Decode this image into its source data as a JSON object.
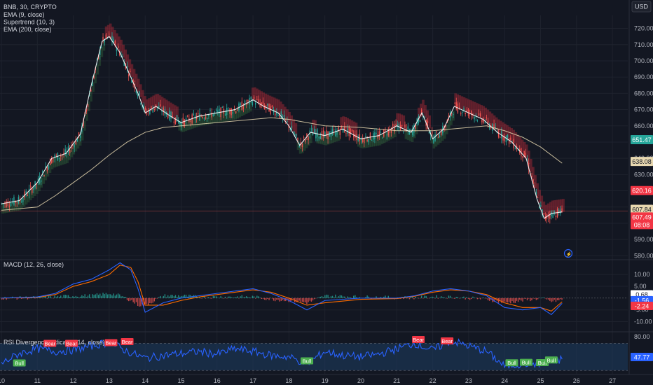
{
  "header": {
    "symbol": "BNB, 30, CRYPTO",
    "indicators": [
      "EMA (9, close)",
      "Supertrend (10, 3)",
      "EMA (200, close)"
    ],
    "currency_button": "USD"
  },
  "colors": {
    "background": "#131722",
    "grid": "#1e222d",
    "bull": "#26a69a",
    "bear": "#ef5350",
    "ema9": "#ffffff",
    "ema200": "#e8d8b0",
    "supertrend_up": "#4caf50",
    "supertrend_down": "#b02a38",
    "macd_line": "#2962ff",
    "signal_line": "#ff6d00",
    "rsi_line": "#2962ff",
    "rsi_band": "#1c3a5e"
  },
  "chart_data": [
    {
      "type": "line",
      "panel": "price",
      "title": "BNB, 30, CRYPTO",
      "x_ticks": [
        "10",
        "11",
        "12",
        "13",
        "14",
        "15",
        "16",
        "17",
        "18",
        "19",
        "20",
        "21",
        "22",
        "23",
        "24",
        "25",
        "26",
        "27"
      ],
      "y_ticks": [
        "720.00",
        "710.00",
        "700.00",
        "690.00",
        "680.00",
        "670.00",
        "660.00",
        "650.00",
        "640.00",
        "630.00",
        "620.00",
        "610.00",
        "600.00",
        "590.00",
        "580.00"
      ],
      "ylim": [
        578,
        728
      ],
      "grid": true,
      "series": [
        {
          "name": "EMA (9, close)",
          "x": [
            10,
            10.5,
            11,
            11.4,
            11.8,
            12.2,
            12.5,
            12.8,
            13.0,
            13.3,
            13.6,
            13.8,
            14.0,
            14.3,
            14.7,
            15.0,
            15.5,
            16.0,
            16.5,
            17.0,
            17.3,
            17.7,
            18.0,
            18.3,
            18.6,
            19.0,
            19.5,
            20.0,
            20.5,
            21.0,
            21.4,
            21.7,
            22.0,
            22.3,
            22.6,
            23.0,
            23.4,
            23.8,
            24.2,
            24.6,
            24.9,
            25.1,
            25.3,
            25.6
          ],
          "values": [
            612,
            614,
            625,
            640,
            643,
            655,
            685,
            712,
            715,
            705,
            690,
            680,
            668,
            672,
            666,
            662,
            666,
            668,
            670,
            676,
            672,
            668,
            660,
            648,
            656,
            654,
            658,
            652,
            654,
            660,
            656,
            668,
            652,
            658,
            672,
            668,
            664,
            656,
            650,
            640,
            615,
            603,
            606,
            607
          ]
        },
        {
          "name": "EMA (200, close)",
          "x": [
            10,
            11,
            11.5,
            12,
            12.5,
            13,
            13.5,
            14,
            14.5,
            15,
            16,
            17,
            17.5,
            18,
            18.5,
            19,
            20,
            21,
            22,
            23,
            23.5,
            24,
            24.5,
            25,
            25.6
          ],
          "values": [
            608,
            610,
            617,
            625,
            633,
            642,
            650,
            656,
            659,
            660,
            662,
            664,
            665,
            664,
            662,
            660,
            659,
            657,
            657,
            659,
            660,
            657,
            653,
            647,
            637
          ]
        }
      ],
      "price_labels": [
        "651.47",
        "638.08",
        "620.16",
        "607.84",
        "607.49",
        "08:08"
      ]
    },
    {
      "type": "line",
      "panel": "macd",
      "title": "MACD (12, 26, close)",
      "y_ticks": [
        "10.00",
        "5.00",
        "-5.00",
        "-10.00"
      ],
      "ylim": [
        -14,
        16
      ],
      "series": [
        {
          "name": "MACD",
          "x": [
            10,
            11,
            11.5,
            12,
            12.5,
            13,
            13.3,
            13.6,
            13.8,
            14.0,
            14.5,
            15,
            15.5,
            16,
            16.5,
            17,
            17.5,
            18,
            18.5,
            19,
            20,
            21,
            21.5,
            22,
            22.5,
            23,
            23.5,
            24,
            24.5,
            25,
            25.3,
            25.6
          ],
          "values": [
            0,
            0.5,
            2,
            6,
            8,
            12,
            15,
            12,
            4,
            -6,
            -2,
            0,
            1,
            2,
            3,
            4,
            2,
            -1,
            -5,
            -1,
            0,
            0,
            1,
            3,
            4,
            3,
            1,
            -4,
            -5,
            -4,
            -7,
            -2.24
          ]
        },
        {
          "name": "Signal",
          "x": [
            10,
            11,
            11.5,
            12,
            12.5,
            13,
            13.3,
            13.6,
            13.8,
            14.0,
            14.5,
            15,
            15.5,
            16,
            16.5,
            17,
            17.5,
            18,
            18.5,
            19,
            20,
            21,
            21.5,
            22,
            22.5,
            23,
            23.5,
            24,
            24.5,
            25,
            25.3,
            25.6
          ],
          "values": [
            0,
            0.3,
            1.5,
            5,
            7,
            10,
            14,
            13,
            7,
            -3,
            -3,
            -1,
            0.5,
            1.5,
            2.5,
            3.5,
            2.5,
            0,
            -3,
            -2,
            -0.5,
            -0.2,
            0.8,
            2.5,
            3.5,
            3,
            1.5,
            -2,
            -4,
            -4,
            -5.5,
            -1.56
          ]
        }
      ],
      "price_labels": [
        "0.68",
        "-1.56",
        "-2.24"
      ]
    },
    {
      "type": "line",
      "panel": "rsi",
      "title": "RSI Divergence Indicator (14, close)",
      "y_ticks": [
        "80.00"
      ],
      "ylim": [
        25,
        85
      ],
      "band": [
        30,
        70
      ],
      "series": [
        {
          "name": "RSI",
          "x": [
            10,
            10.5,
            11,
            11.5,
            12,
            12.5,
            13,
            13.5,
            14,
            14.5,
            15,
            15.5,
            16,
            16.5,
            17,
            17.5,
            18,
            18.5,
            19,
            19.5,
            20,
            20.5,
            21,
            21.5,
            22,
            22.5,
            23,
            23.5,
            24,
            24.5,
            25,
            25.5,
            25.6
          ],
          "values": [
            40,
            55,
            62,
            58,
            60,
            66,
            72,
            58,
            48,
            52,
            55,
            58,
            54,
            62,
            58,
            52,
            50,
            40,
            58,
            52,
            50,
            54,
            62,
            70,
            60,
            74,
            66,
            58,
            36,
            40,
            40,
            44,
            47.77
          ]
        }
      ],
      "labels": [
        {
          "text": "Bull",
          "x": 10.5,
          "kind": "bull"
        },
        {
          "text": "Bear",
          "x": 11.35,
          "kind": "bear"
        },
        {
          "text": "Bear",
          "x": 11.95,
          "kind": "bear"
        },
        {
          "text": "Bear",
          "x": 13.05,
          "kind": "bear"
        },
        {
          "text": "Bear",
          "x": 13.5,
          "kind": "bear"
        },
        {
          "text": "Bull",
          "x": 18.5,
          "kind": "bull"
        },
        {
          "text": "Bear",
          "x": 21.6,
          "kind": "bear"
        },
        {
          "text": "Bear",
          "x": 22.4,
          "kind": "bear"
        },
        {
          "text": "Bull",
          "x": 24.2,
          "kind": "bull"
        },
        {
          "text": "Bull",
          "x": 24.6,
          "kind": "bull"
        },
        {
          "text": "Bull",
          "x": 25.05,
          "kind": "bull"
        },
        {
          "text": "Bull",
          "x": 25.3,
          "kind": "bull"
        }
      ],
      "price_labels": [
        "47.77"
      ]
    }
  ]
}
